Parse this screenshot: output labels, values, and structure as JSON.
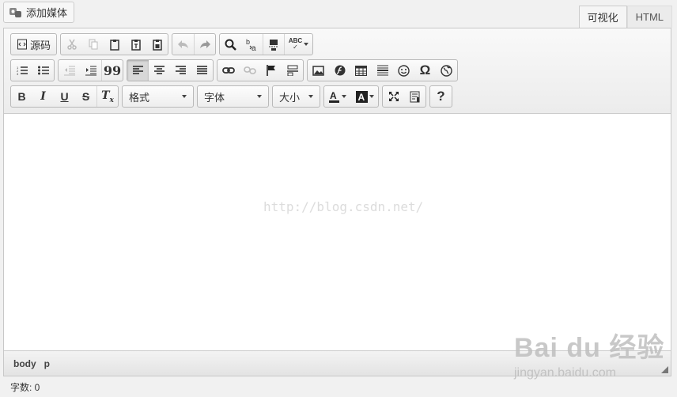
{
  "top": {
    "add_media_label": "添加媒体",
    "tabs": [
      {
        "label": "可视化",
        "active": true
      },
      {
        "label": "HTML",
        "active": false
      }
    ]
  },
  "toolbar": {
    "source_label": "源码",
    "format_select": "格式",
    "font_select": "字体",
    "size_select": "大小",
    "help_label": "?",
    "spellcheck_label": "ABC",
    "quote_label": "99",
    "omega_label": "Ω",
    "bold": "B",
    "italic": "I",
    "underline": "U",
    "strike": "S",
    "clear_format": "T"
  },
  "content": {
    "watermark": "http://blog.csdn.net/"
  },
  "statusbar": {
    "path": [
      "body",
      "p"
    ]
  },
  "wordcount": "字数: 0",
  "overlay": {
    "logo": "Bai du 经验",
    "url": "jingyan.baidu.com"
  },
  "colors": {
    "toolbar_bg": "#ececec",
    "border": "#c8c8c8",
    "pressed": "#d8d8d8"
  }
}
